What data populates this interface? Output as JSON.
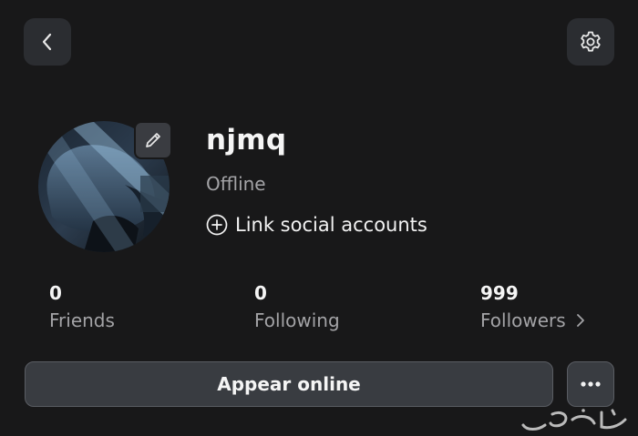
{
  "header": {
    "back_icon": "chevron-left-icon",
    "settings_icon": "gear-icon"
  },
  "profile": {
    "username": "njmq",
    "status": "Offline",
    "link_social_label": "Link social accounts",
    "edit_icon": "pencil-icon"
  },
  "stats": [
    {
      "value": "0",
      "label": "Friends"
    },
    {
      "value": "0",
      "label": "Following"
    },
    {
      "value": "999",
      "label": "Followers"
    }
  ],
  "actions": {
    "appear_online_label": "Appear online",
    "more_icon": "ellipsis-icon"
  },
  "watermark": {
    "text": "حراج"
  },
  "colors": {
    "background": "#181819",
    "button_bg": "#393c41",
    "muted_text": "#a3a3a6"
  }
}
